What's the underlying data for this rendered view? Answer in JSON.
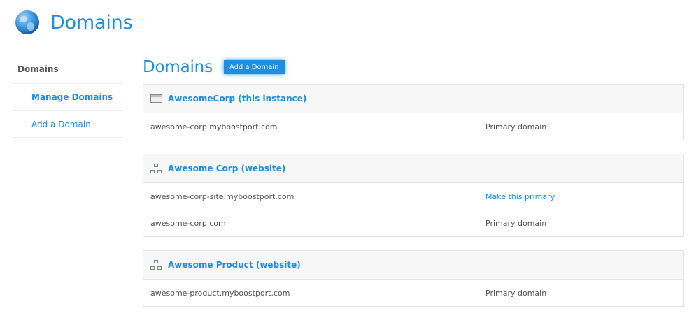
{
  "header": {
    "title": "Domains",
    "icon": "globe-icon"
  },
  "sidebar": {
    "title": "Domains",
    "items": [
      {
        "label": "Manage Domains",
        "active": true
      },
      {
        "label": "Add a Domain",
        "active": false
      }
    ]
  },
  "main": {
    "title": "Domains",
    "add_button": "Add a Domain"
  },
  "groups": [
    {
      "name": "AwesomeCorp (this instance)",
      "icon": "window-icon",
      "rows": [
        {
          "domain": "awesome-corp.myboostport.com",
          "status": "Primary domain",
          "status_is_link": false
        }
      ]
    },
    {
      "name": "Awesome Corp (website)",
      "icon": "sitemap-icon",
      "rows": [
        {
          "domain": "awesome-corp-site.myboostport.com",
          "status": "Make this primary",
          "status_is_link": true
        },
        {
          "domain": "awesome-corp.com",
          "status": "Primary domain",
          "status_is_link": false
        }
      ]
    },
    {
      "name": "Awesome Product (website)",
      "icon": "sitemap-icon",
      "rows": [
        {
          "domain": "awesome-product.myboostport.com",
          "status": "Primary domain",
          "status_is_link": false
        }
      ]
    }
  ],
  "colors": {
    "accent": "#1d8ee0",
    "panel_bg": "#f7f7f7",
    "border": "#e4e4e4"
  }
}
